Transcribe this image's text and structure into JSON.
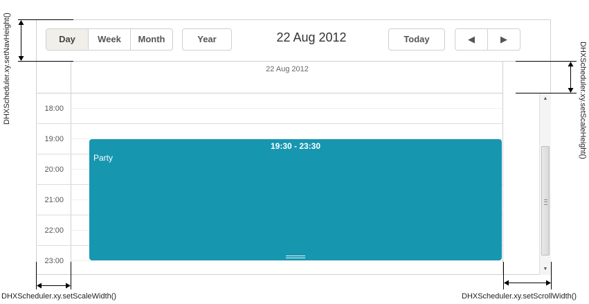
{
  "toolbar": {
    "views": [
      {
        "label": "Day",
        "active": true
      },
      {
        "label": "Week",
        "active": false
      },
      {
        "label": "Month",
        "active": false
      }
    ],
    "year_label": "Year",
    "date_title": "22 Aug 2012",
    "today_label": "Today",
    "prev_icon": "◀",
    "next_icon": "▶"
  },
  "day_header": "22 Aug 2012",
  "time_labels": [
    "18:00",
    "19:00",
    "20:00",
    "21:00",
    "22:00",
    "23:00"
  ],
  "event": {
    "time": "19:30 - 23:30",
    "text": "Party",
    "color": "#1796b0"
  },
  "annotations": {
    "nav_height": "DHXScheduler.xy.setNavHeight()",
    "scale_height": "DHXScheduler.xy.setScaleHeight()",
    "scale_width": "DHXScheduler.xy.setScaleWidth()",
    "scroll_width": "DHXScheduler.xy.setScrollWidth()"
  }
}
